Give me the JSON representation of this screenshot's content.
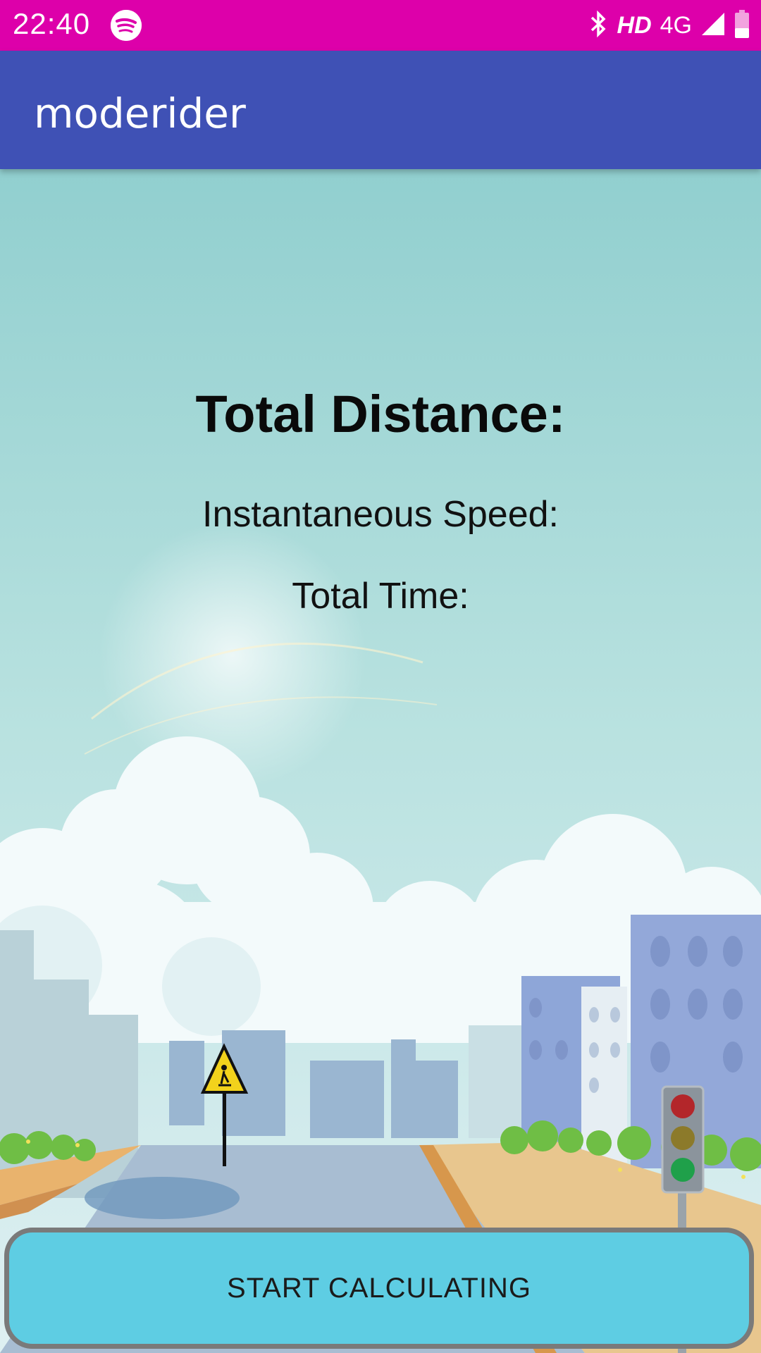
{
  "status_bar": {
    "time": "22:40",
    "hd": "HD",
    "network": "4G",
    "icons": [
      "spotify-icon",
      "bluetooth-icon",
      "signal-icon",
      "battery-icon"
    ],
    "color": "#dd00aa"
  },
  "app_bar": {
    "title": "moderider",
    "color": "#3f51b5"
  },
  "main": {
    "total_distance_label": "Total Distance:",
    "instantaneous_speed_label": "Instantaneous Speed:",
    "total_time_label": "Total Time:"
  },
  "button": {
    "label": "START CALCULATING",
    "color": "#5ecde3"
  }
}
